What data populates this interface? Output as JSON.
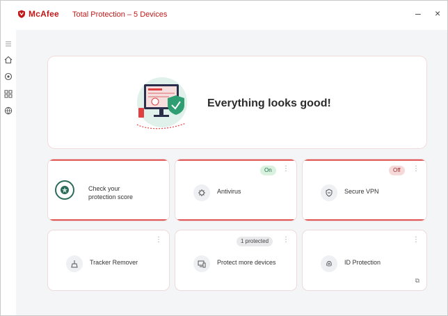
{
  "titlebar": {
    "brand": "McAfee",
    "title": "Total Protection – 5 Devices",
    "minimize": "–",
    "close": "×"
  },
  "sidebar": {
    "items": [
      {
        "icon": "menu-icon"
      },
      {
        "icon": "home-icon"
      },
      {
        "icon": "protection-icon"
      },
      {
        "icon": "apps-grid-icon"
      },
      {
        "icon": "globe-icon"
      }
    ]
  },
  "hero": {
    "title": "Everything looks good!"
  },
  "cards": {
    "protection_score": {
      "label_line1": "Check your",
      "label_line2": "protection score"
    },
    "antivirus": {
      "label": "Antivirus",
      "badge": "On"
    },
    "vpn": {
      "label": "Secure VPN",
      "badge": "Off"
    },
    "tracker": {
      "label": "Tracker Remover"
    },
    "devices": {
      "label": "Protect more devices",
      "badge": "1 protected"
    },
    "id_protection": {
      "label": "ID Protection"
    }
  },
  "colors": {
    "brand": "#c01818",
    "accent_bar": "#e25555",
    "on_badge_bg": "#d9f2e0",
    "off_badge_bg": "#f6dada"
  }
}
